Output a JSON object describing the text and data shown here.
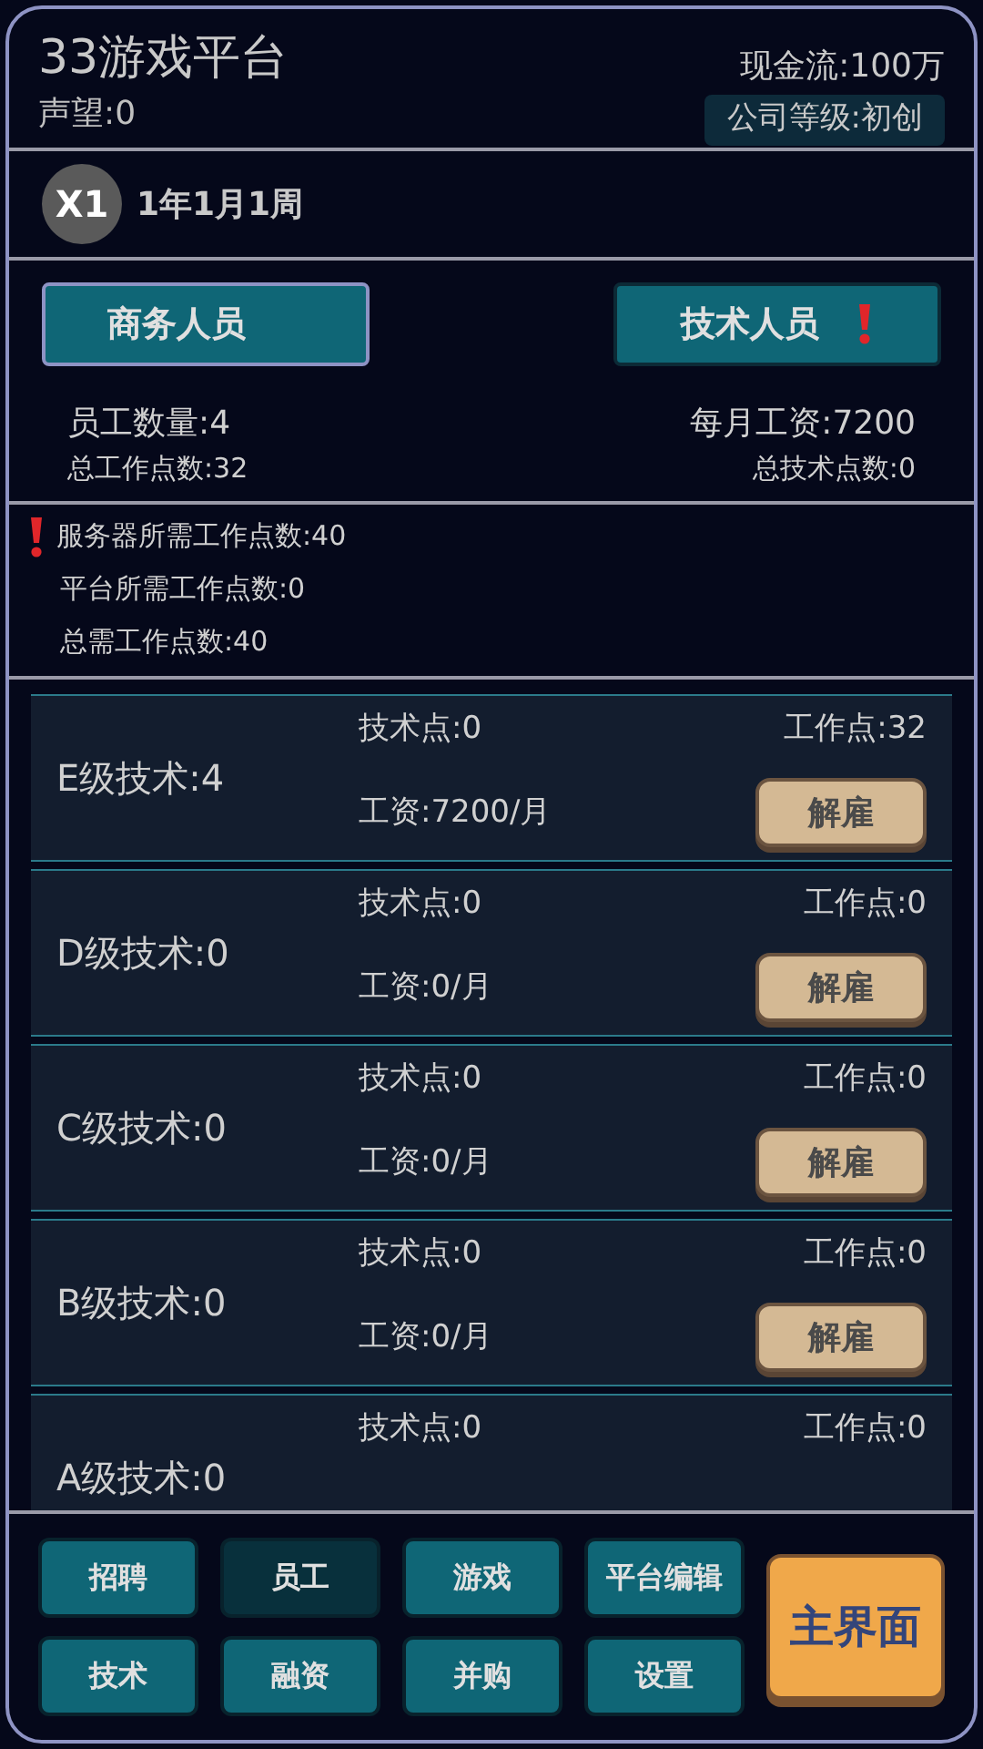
{
  "header": {
    "title": "33游戏平台",
    "reputation": "声望:0",
    "cash": "现金流:100万",
    "level_badge": "公司等级:初创"
  },
  "time": {
    "speed": "X1",
    "date": "1年1月1周"
  },
  "tabs": [
    {
      "label": "商务人员",
      "selected": true,
      "alert": false
    },
    {
      "label": "技术人员",
      "selected": false,
      "alert": true
    }
  ],
  "summary": {
    "staff_count": "员工数量:4",
    "monthly_salary": "每月工资:7200",
    "total_work_points": "总工作点数:32",
    "total_tech_points": "总技术点数:0"
  },
  "requirements": [
    {
      "text": "服务器所需工作点数:40",
      "alert": true
    },
    {
      "text": "平台所需工作点数:0",
      "alert": false
    },
    {
      "text": "总需工作点数:40",
      "alert": false
    }
  ],
  "staff_rows": [
    {
      "grade": "E级技术:4",
      "tech_points": "技术点:0",
      "work_points": "工作点:32",
      "salary": "工资:7200/月",
      "button": "解雇"
    },
    {
      "grade": "D级技术:0",
      "tech_points": "技术点:0",
      "work_points": "工作点:0",
      "salary": "工资:0/月",
      "button": "解雇"
    },
    {
      "grade": "C级技术:0",
      "tech_points": "技术点:0",
      "work_points": "工作点:0",
      "salary": "工资:0/月",
      "button": "解雇"
    },
    {
      "grade": "B级技术:0",
      "tech_points": "技术点:0",
      "work_points": "工作点:0",
      "salary": "工资:0/月",
      "button": "解雇"
    },
    {
      "grade": "A级技术:0",
      "tech_points": "技术点:0",
      "work_points": "工作点:0"
    }
  ],
  "nav": [
    {
      "label": "招聘",
      "selected": false
    },
    {
      "label": "员工",
      "selected": true
    },
    {
      "label": "游戏",
      "selected": false
    },
    {
      "label": "平台编辑",
      "selected": false
    },
    {
      "label": "技术",
      "selected": false
    },
    {
      "label": "融资",
      "selected": false
    },
    {
      "label": "并购",
      "selected": false
    },
    {
      "label": "设置",
      "selected": false
    }
  ],
  "main_button": "主界面"
}
